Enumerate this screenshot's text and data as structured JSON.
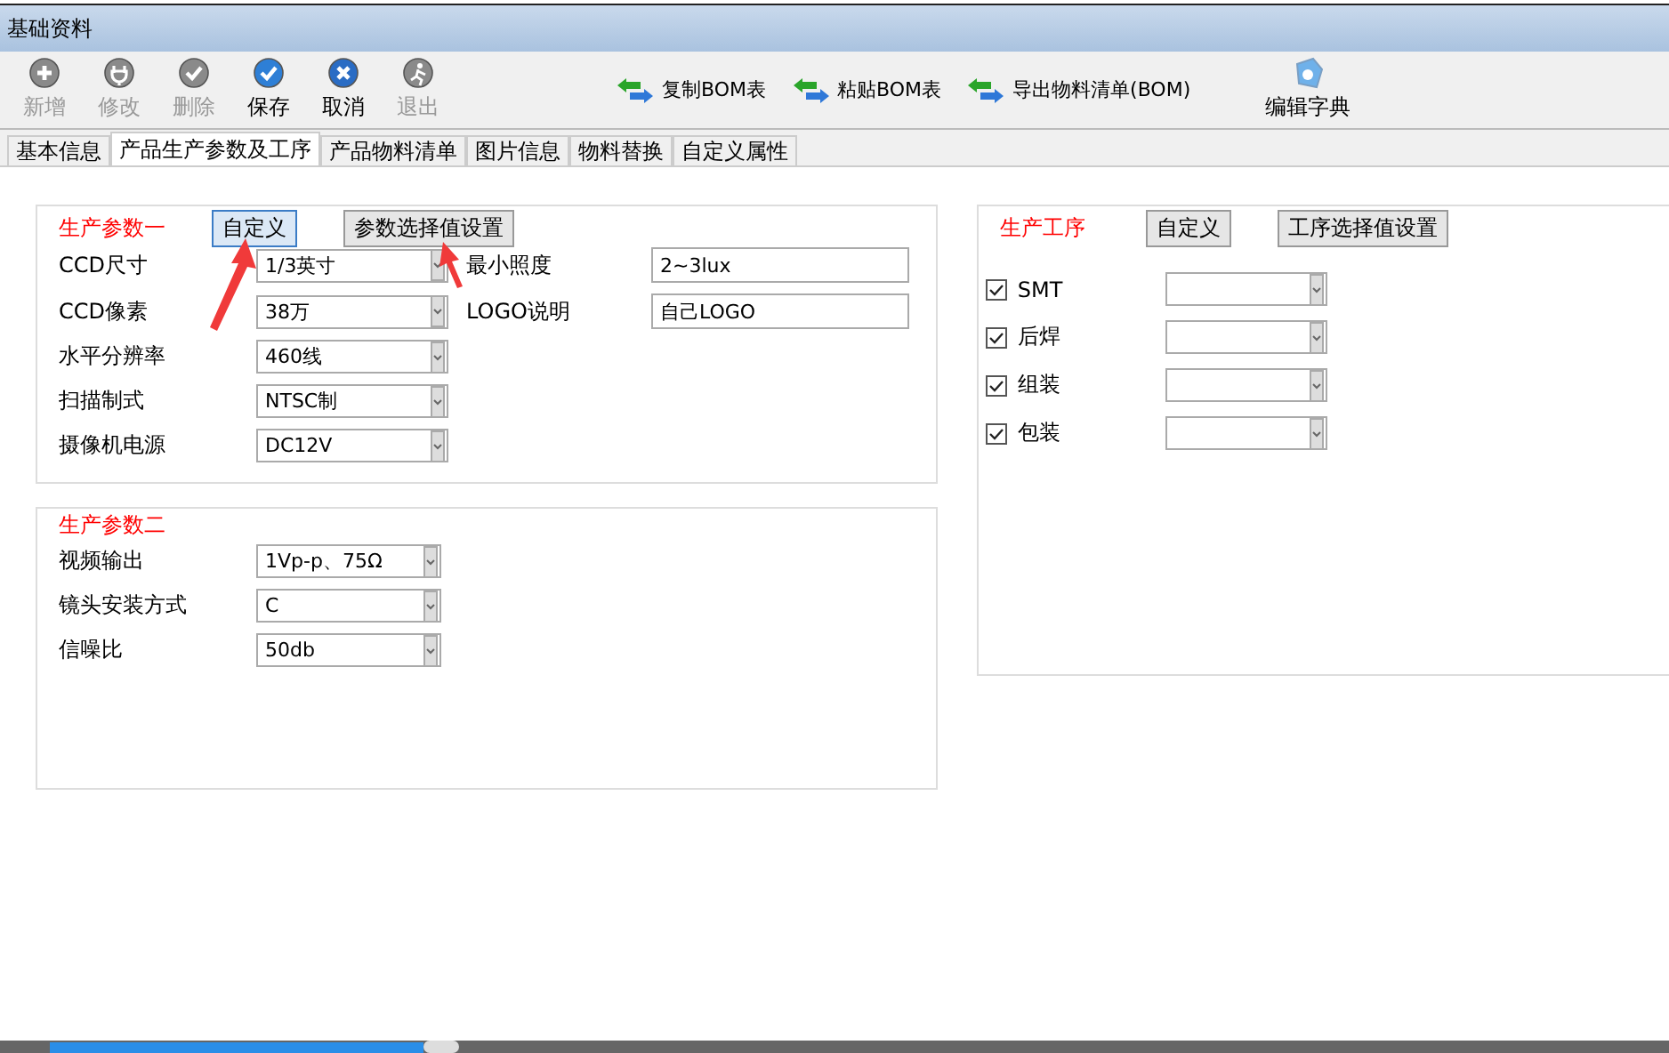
{
  "window": {
    "title": "基础资料"
  },
  "toolbar": [
    {
      "label": "新增",
      "kind": "plus",
      "disabled": true
    },
    {
      "label": "修改",
      "kind": "edit",
      "disabled": true
    },
    {
      "label": "删除",
      "kind": "check",
      "disabled": true
    },
    {
      "label": "保存",
      "kind": "check",
      "disabled": false
    },
    {
      "label": "取消",
      "kind": "cross",
      "disabled": false
    },
    {
      "label": "退出",
      "kind": "exit",
      "disabled": true
    }
  ],
  "bom_actions": [
    {
      "label": "复制BOM表"
    },
    {
      "label": "粘贴BOM表"
    },
    {
      "label": "导出物料清单(BOM)"
    }
  ],
  "dictionary_button": {
    "label": "编辑字典"
  },
  "tabs": [
    {
      "label": "基本信息",
      "selected": false
    },
    {
      "label": "产品生产参数及工序",
      "selected": true
    },
    {
      "label": "产品物料清单",
      "selected": false
    },
    {
      "label": "图片信息",
      "selected": false
    },
    {
      "label": "物料替换",
      "selected": false
    },
    {
      "label": "自定义属性",
      "selected": false
    }
  ],
  "params_one": {
    "title": "生产参数一",
    "custom_button": "自定义",
    "settings_button": "参数选择值设置",
    "rows": [
      {
        "label": "CCD尺寸",
        "value": "1/3英寸"
      },
      {
        "label": "CCD像素",
        "value": "38万"
      },
      {
        "label": "水平分辨率",
        "value": "460线"
      },
      {
        "label": "扫描制式",
        "value": "NTSC制"
      },
      {
        "label": "摄像机电源",
        "value": "DC12V"
      }
    ],
    "text_rows": [
      {
        "label": "最小照度",
        "value": "2~3lux"
      },
      {
        "label": "LOGO说明",
        "value": "自己LOGO"
      }
    ]
  },
  "params_two": {
    "title": "生产参数二",
    "rows": [
      {
        "label": "视频输出",
        "value": "1Vp-p、75Ω"
      },
      {
        "label": "镜头安装方式",
        "value": "C"
      },
      {
        "label": "信噪比",
        "value": "50db"
      }
    ]
  },
  "processes": {
    "title": "生产工序",
    "custom_button": "自定义",
    "settings_button": "工序选择值设置",
    "items": [
      {
        "label": "SMT",
        "checked": true
      },
      {
        "label": "后焊",
        "checked": true
      },
      {
        "label": "组装",
        "checked": true
      },
      {
        "label": "包装",
        "checked": true
      }
    ]
  }
}
